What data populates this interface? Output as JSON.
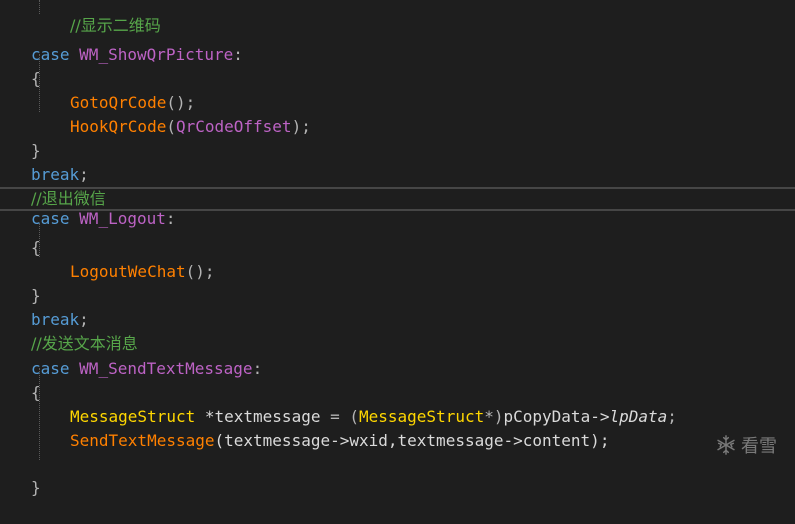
{
  "code": {
    "line0_comment": "//显示二维码",
    "case_kw": "case",
    "break_kw": "break",
    "open_brace": "{",
    "close_brace": "}",
    "colon": ":",
    "semicolon": ";",
    "call_parens": "()",
    "case1_label": "WM_ShowQrPicture",
    "goto_fn": "GotoQrCode",
    "hook_fn": "HookQrCode",
    "hook_open": "(",
    "hook_arg": "QrCodeOffset",
    "hook_close": ");",
    "comment_logout": "//退出微信",
    "case2_label": "WM_Logout",
    "logout_fn": "LogoutWeChat",
    "comment_send": "//发送文本消息",
    "case3_label": "WM_SendTextMessage",
    "msg_type": "MessageStruct",
    "msg_star": " *",
    "msg_var": "textmessage",
    "msg_eq": " = (",
    "msg_cast": "MessageStruct",
    "msg_cast_end": "*)",
    "msg_src": "pCopyData->",
    "msg_field": "lpData",
    "send_fn": "SendTextMessage",
    "send_args": "(textmessage->wxid,textmessage->content);"
  },
  "watermark": {
    "text": "看雪",
    "icon": "snowflake-icon"
  }
}
